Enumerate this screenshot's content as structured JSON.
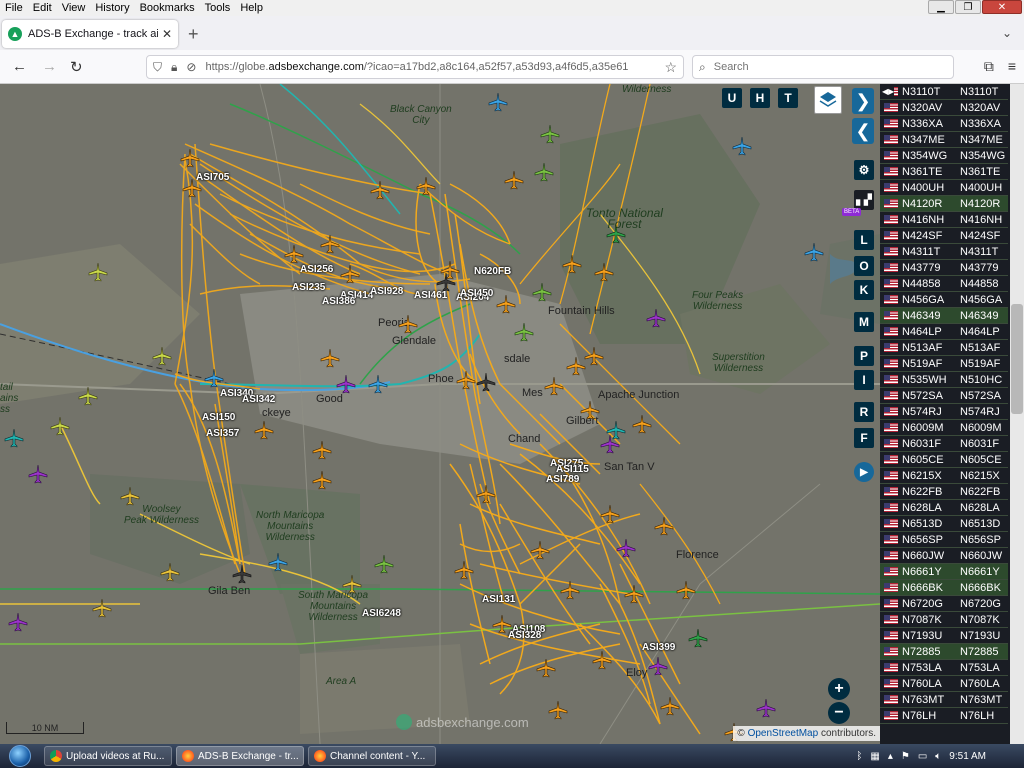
{
  "menu": [
    "File",
    "Edit",
    "View",
    "History",
    "Bookmarks",
    "Tools",
    "Help"
  ],
  "tab": {
    "title": "ADS-B Exchange - track aircraft"
  },
  "nav": {
    "url_prefix": "https://globe.",
    "url_domain": "adsbexchange.com",
    "url_rest": "/?icao=a17bd2,a8c164,a52f57,a53d93,a4f6d5,a35e61",
    "search_placeholder": "Search"
  },
  "map": {
    "labels": {
      "black_canyon_city": "Black Canyon\nCity",
      "wilderness_top": "Wilderness",
      "tonto": "Tonto National\nForest",
      "four_peaks": "Four Peaks\nWilderness",
      "superstition": "Superstition\nWilderness",
      "woolsey": "Woolsey\nPeak Wilderness",
      "north_maricopa": "North Maricopa\nMountains\nWilderness",
      "south_maricopa": "South Maricopa\nMountains\nWilderness",
      "area_a": "Area A",
      "peoria": "Peoria",
      "glendale": "Glendale",
      "phoenix": "Phoe",
      "mesa": "Mes",
      "chandler": "Chand",
      "gilbert": "Gilbert",
      "fountain_hills": "Fountain Hills",
      "scottsdale": "sdale",
      "buckeye": "ckeye",
      "goodyear": "Good",
      "apache_junction": "Apache Junction",
      "san_tan_valley": "San Tan V",
      "florence": "Florence",
      "eloy": "Eloy",
      "gila_bend": "Gila Ben",
      "left_wilderness": "tail\nains\nss"
    },
    "callsigns": [
      "ASI705",
      "ASI256",
      "ASI235",
      "ASI414",
      "ASI386",
      "ASI928",
      "ASI461",
      "ASI204",
      "ASI450",
      "N620FB",
      "ASI340",
      "ASI342",
      "ASI150",
      "ASI357",
      "ASI275",
      "ASI115",
      "ASI789",
      "ASI6248",
      "ASI131",
      "ASI108",
      "ASI328",
      "ASI399"
    ],
    "buttons": {
      "u": "U",
      "h": "H",
      "t": "T",
      "l": "L",
      "o": "O",
      "k": "K",
      "m": "M",
      "p": "P",
      "i": "I",
      "r": "R",
      "f": "F",
      "beta": "BETA",
      "zoom_in": "+",
      "zoom_out": "−"
    },
    "scale_label": "10 NM",
    "watermark": "adsbexchange.com",
    "attribution_link": "OpenStreetMap",
    "attribution_rest": "contributors."
  },
  "table": {
    "rows": [
      {
        "reg": "N3110T",
        "call": "N3110T",
        "bg": "#1a1d24"
      },
      {
        "reg": "N320AV",
        "call": "N320AV",
        "bg": "#1a1d24"
      },
      {
        "reg": "N336XA",
        "call": "N336XA",
        "bg": "#1a1d24"
      },
      {
        "reg": "N347ME",
        "call": "N347ME",
        "bg": "#1a1d24"
      },
      {
        "reg": "N354WG",
        "call": "N354WG",
        "bg": "#1a1d24"
      },
      {
        "reg": "N361TE",
        "call": "N361TE",
        "bg": "#1a1d24"
      },
      {
        "reg": "N400UH",
        "call": "N400UH",
        "bg": "#1a1d24"
      },
      {
        "reg": "N4120R",
        "call": "N4120R",
        "bg": "#2d4a2d"
      },
      {
        "reg": "N416NH",
        "call": "N416NH",
        "bg": "#1a1d24"
      },
      {
        "reg": "N424SF",
        "call": "N424SF",
        "bg": "#1a1d24"
      },
      {
        "reg": "N4311T",
        "call": "N4311T",
        "bg": "#1a1d24"
      },
      {
        "reg": "N43779",
        "call": "N43779",
        "bg": "#1a1d24"
      },
      {
        "reg": "N44858",
        "call": "N44858",
        "bg": "#1a1d24"
      },
      {
        "reg": "N456GA",
        "call": "N456GA",
        "bg": "#1a1d24"
      },
      {
        "reg": "N46349",
        "call": "N46349",
        "bg": "#2d4a2d"
      },
      {
        "reg": "N464LP",
        "call": "N464LP",
        "bg": "#1a1d24"
      },
      {
        "reg": "N513AF",
        "call": "N513AF",
        "bg": "#1a1d24"
      },
      {
        "reg": "N519AF",
        "call": "N519AF",
        "bg": "#1a1d24"
      },
      {
        "reg": "N535WH",
        "call": "N510HC",
        "bg": "#1a1d24"
      },
      {
        "reg": "N572SA",
        "call": "N572SA",
        "bg": "#1a1d24"
      },
      {
        "reg": "N574RJ",
        "call": "N574RJ",
        "bg": "#1a1d24"
      },
      {
        "reg": "N6009M",
        "call": "N6009M",
        "bg": "#1a1d24"
      },
      {
        "reg": "N6031F",
        "call": "N6031F",
        "bg": "#1a1d24"
      },
      {
        "reg": "N605CE",
        "call": "N605CE",
        "bg": "#1a1d24"
      },
      {
        "reg": "N6215X",
        "call": "N6215X",
        "bg": "#1a1d24"
      },
      {
        "reg": "N622FB",
        "call": "N622FB",
        "bg": "#1a1d24"
      },
      {
        "reg": "N628LA",
        "call": "N628LA",
        "bg": "#1a1d24"
      },
      {
        "reg": "N6513D",
        "call": "N6513D",
        "bg": "#1a1d24"
      },
      {
        "reg": "N656SP",
        "call": "N656SP",
        "bg": "#1a1d24"
      },
      {
        "reg": "N660JW",
        "call": "N660JW",
        "bg": "#1a1d24"
      },
      {
        "reg": "N6661Y",
        "call": "N6661Y",
        "bg": "#2d4a2d"
      },
      {
        "reg": "N666BK",
        "call": "N666BK",
        "bg": "#2d4a2d"
      },
      {
        "reg": "N6720G",
        "call": "N6720G",
        "bg": "#1a1d24"
      },
      {
        "reg": "N7087K",
        "call": "N7087K",
        "bg": "#1a1d24"
      },
      {
        "reg": "N7193U",
        "call": "N7193U",
        "bg": "#1a1d24"
      },
      {
        "reg": "N72885",
        "call": "N72885",
        "bg": "#2d4a2d"
      },
      {
        "reg": "N753LA",
        "call": "N753LA",
        "bg": "#1a1d24"
      },
      {
        "reg": "N760LA",
        "call": "N760LA",
        "bg": "#1a1d24"
      },
      {
        "reg": "N763MT",
        "call": "N763MT",
        "bg": "#1a1d24"
      },
      {
        "reg": "N76LH",
        "call": "N76LH",
        "bg": "#1a1d24"
      }
    ]
  },
  "taskbar": {
    "tasks": [
      {
        "label": "Upload videos at Ru...",
        "color": "#e8b21e"
      },
      {
        "label": "ADS-B Exchange - tr...",
        "color": "#ff7a1a"
      },
      {
        "label": "Channel content - Y...",
        "color": "#ff7a1a"
      }
    ],
    "time": "9:51 AM"
  },
  "colors": {
    "track_orange": "#f2a91c",
    "track_yellow": "#e9c33a",
    "plane_orange": "#f5a01c",
    "plane_green": "#7ac142",
    "plane_blue": "#3ba4e6",
    "plane_purple": "#9b34c9",
    "button_dark": "#002c40",
    "button_blue": "#17689a"
  }
}
